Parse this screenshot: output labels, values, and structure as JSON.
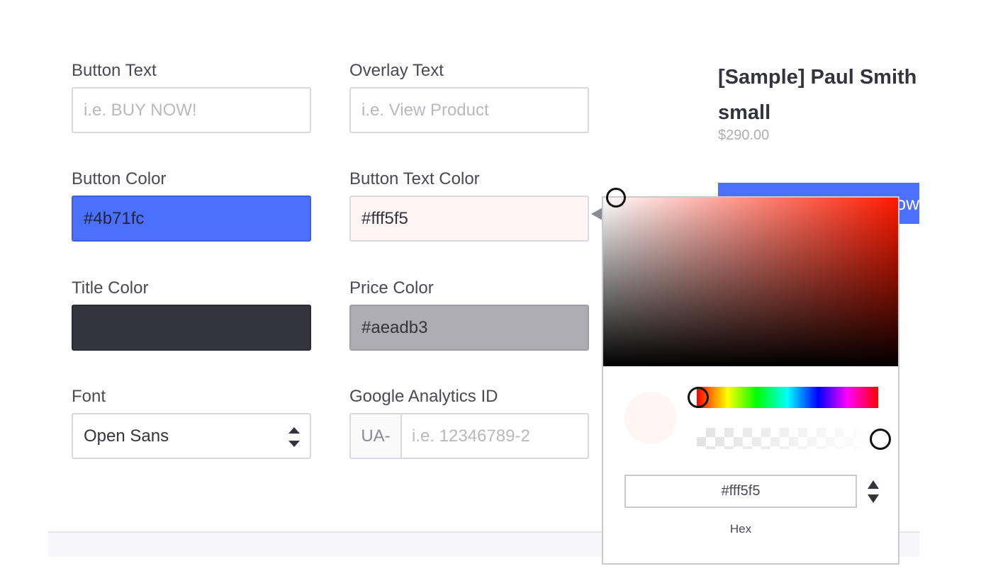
{
  "form": {
    "button_text": {
      "label": "Button Text",
      "placeholder": "i.e. BUY NOW!"
    },
    "overlay_text": {
      "label": "Overlay Text",
      "placeholder": "i.e. View Product"
    },
    "button_color": {
      "label": "Button Color",
      "value": "#4b71fc",
      "color": "#4b71fc"
    },
    "button_text_color": {
      "label": "Button Text Color",
      "value": "#fff5f5",
      "color": "#fff5f5"
    },
    "title_color": {
      "label": "Title Color",
      "value": "",
      "color": "#34343f"
    },
    "price_color": {
      "label": "Price Color",
      "value": "#aeadb3",
      "color": "#aeadb3"
    },
    "font": {
      "label": "Font",
      "value": "Open Sans"
    },
    "analytics": {
      "label": "Google Analytics ID",
      "prefix": "UA-",
      "placeholder": "i.e. 12346789-2"
    }
  },
  "preview": {
    "title_line1": "[Sample] Paul Smith",
    "title_line2": "small",
    "price": "$290.00",
    "button_text_partial": "ow"
  },
  "picker": {
    "hex_value": "#fff5f5",
    "mode_label": "Hex",
    "selected_color": "#fff5f5"
  }
}
